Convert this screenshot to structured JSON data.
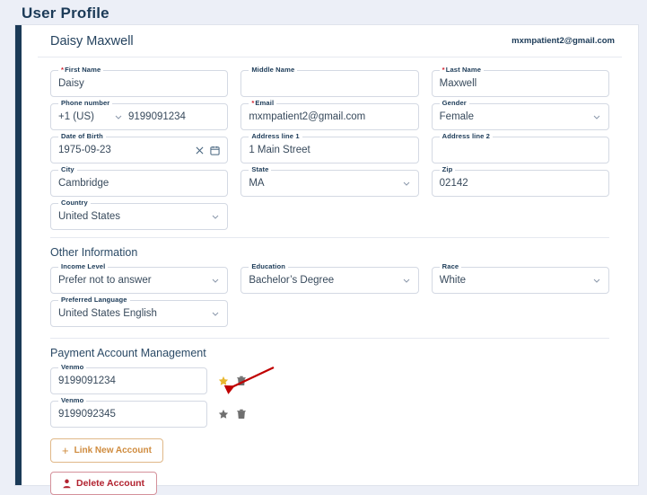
{
  "page": {
    "title": "User Profile"
  },
  "card": {
    "user_name": "Daisy Maxwell",
    "user_email": "mxmpatient2@gmail.com"
  },
  "personal": {
    "fields": {
      "first_name": {
        "label": "First Name",
        "required": true,
        "value": "Daisy"
      },
      "middle_name": {
        "label": "Middle Name",
        "required": false,
        "value": ""
      },
      "last_name": {
        "label": "Last Name",
        "required": true,
        "value": "Maxwell"
      },
      "phone_number": {
        "label": "Phone number",
        "required": false,
        "country_code": "+1 (US)",
        "value": "9199091234"
      },
      "email": {
        "label": "Email",
        "required": true,
        "value": "mxmpatient2@gmail.com"
      },
      "gender": {
        "label": "Gender",
        "required": false,
        "value": "Female"
      },
      "date_of_birth": {
        "label": "Date of Birth",
        "required": false,
        "value": "1975-09-23"
      },
      "address_line_1": {
        "label": "Address line 1",
        "required": false,
        "value": "1 Main Street"
      },
      "address_line_2": {
        "label": "Address line 2",
        "required": false,
        "value": ""
      },
      "city": {
        "label": "City",
        "required": false,
        "value": "Cambridge"
      },
      "state": {
        "label": "State",
        "required": false,
        "value": "MA"
      },
      "zip": {
        "label": "Zip",
        "required": false,
        "value": "02142"
      },
      "country": {
        "label": "Country",
        "required": false,
        "value": "United States"
      }
    }
  },
  "other_information": {
    "heading": "Other Information",
    "fields": {
      "income_level": {
        "label": "Income Level",
        "value": "Prefer not to answer"
      },
      "education": {
        "label": "Education",
        "value": "Bachelor’s Degree"
      },
      "race": {
        "label": "Race",
        "value": "White"
      },
      "preferred_language": {
        "label": "Preferred Language",
        "value": "United States English"
      }
    }
  },
  "payment": {
    "heading": "Payment Account Management",
    "accounts": [
      {
        "label": "Venmo",
        "value": "9199091234",
        "is_default": true
      },
      {
        "label": "Venmo",
        "value": "9199092345",
        "is_default": false
      }
    ],
    "link_new_account_label": "Link New Account",
    "link_new_account_plus": "+"
  },
  "footer": {
    "delete_account_label": "Delete Account"
  },
  "colors": {
    "page_background": "#eceff7",
    "accent_navy": "#1b3a57",
    "required_red": "#d1212f",
    "link_orange": "#cf8b3e",
    "delete_red": "#b2222f",
    "star_active": "#e8b730",
    "star_inactive": "#6f6f6f",
    "annotation_arrow": "#c00000"
  }
}
